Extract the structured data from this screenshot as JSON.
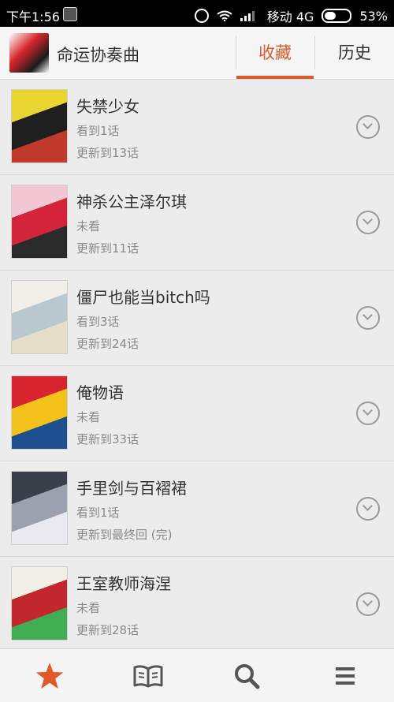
{
  "status_bar": {
    "time": "下午1:56",
    "carrier": "移动 4G",
    "battery_text": "53%",
    "battery_level": 0.53
  },
  "header": {
    "app_title": "命运协奏曲",
    "tabs": [
      {
        "label": "收藏",
        "active": true
      },
      {
        "label": "历史",
        "active": false
      }
    ],
    "accent_color": "#e0592a"
  },
  "comics": [
    {
      "title": "失禁少女",
      "watched": "看到1话",
      "updated": "更新到13话",
      "cover_colors": [
        "#e9d530",
        "#1f1f1f",
        "#c0392b"
      ]
    },
    {
      "title": "神杀公主泽尔琪",
      "watched": "未看",
      "updated": "更新到11话",
      "cover_colors": [
        "#f3c6d3",
        "#d4243b",
        "#2b2b2b"
      ]
    },
    {
      "title": "僵尸也能当bitch吗",
      "watched": "看到3话",
      "updated": "更新到24话",
      "cover_colors": [
        "#f1efe9",
        "#b9c7cf",
        "#e6dfc8"
      ]
    },
    {
      "title": "俺物语",
      "watched": "未看",
      "updated": "更新到33话",
      "cover_colors": [
        "#d8242e",
        "#f2c21b",
        "#1e4f8f"
      ]
    },
    {
      "title": "手里剑与百褶裙",
      "watched": "看到1话",
      "updated": "更新到最终回 (完)",
      "cover_colors": [
        "#3b3f4a",
        "#9ba1ad",
        "#e9e9ef"
      ]
    },
    {
      "title": "王室教师海涅",
      "watched": "未看",
      "updated": "更新到28话",
      "cover_colors": [
        "#f2efe6",
        "#c1272d",
        "#3fae52"
      ]
    }
  ],
  "bottom_nav": [
    {
      "name": "favorites",
      "icon": "star-icon",
      "color": "#e0592a"
    },
    {
      "name": "library",
      "icon": "book-icon",
      "color": "#555555"
    },
    {
      "name": "search",
      "icon": "search-icon",
      "color": "#555555"
    },
    {
      "name": "menu",
      "icon": "menu-icon",
      "color": "#555555"
    }
  ]
}
